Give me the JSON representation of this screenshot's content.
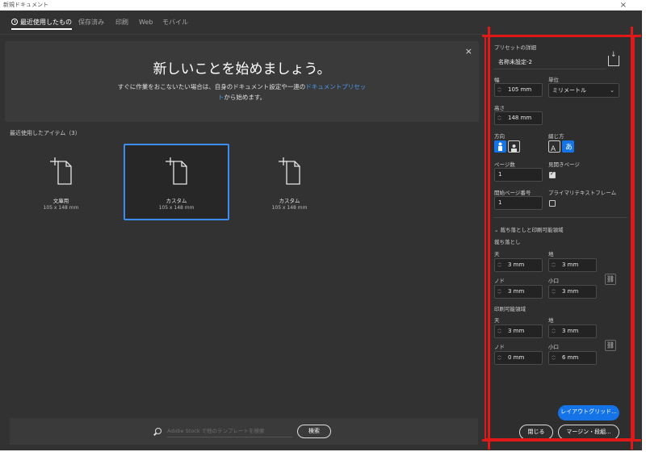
{
  "window": {
    "title": "新規ドキュメント",
    "close": "×"
  },
  "tabs": [
    {
      "label": "最近使用したもの"
    },
    {
      "label": "保存済み"
    },
    {
      "label": "印刷"
    },
    {
      "label": "Web"
    },
    {
      "label": "モバイル"
    }
  ],
  "hero": {
    "close": "×",
    "title": "新しいことを始めましょう。",
    "line1_pre": "すぐに作業をおこないたい場合は、自身のドキュメント設定や一連の",
    "line1_link": "ドキュメントプリセッ",
    "line2_link": "ト",
    "line2_post": "から始めます。"
  },
  "recent": {
    "title": "最近使用したアイテム（3）",
    "items": [
      {
        "name": "文庫用",
        "size": "105 x 148 mm"
      },
      {
        "name": "カスタム",
        "size": "105 x 148 mm"
      },
      {
        "name": "カスタム",
        "size": "105 x 148 mm"
      }
    ]
  },
  "search": {
    "placeholder": "Adobe Stock で他のテンプレートを検索",
    "button": "検索"
  },
  "preset": {
    "header": "プリセットの詳細",
    "name": "名称未設定-2",
    "width_label": "幅",
    "width": "105 mm",
    "unit_label": "単位",
    "unit": "ミリメートル",
    "height_label": "高さ",
    "height": "148 mm",
    "orientation_label": "方向",
    "binding_label": "綴じ方",
    "pages_label": "ページ数",
    "pages": "1",
    "facing_label": "見開きページ",
    "start_page_label": "開始ページ番号",
    "start_page": "1",
    "primary_frame_label": "プライマリテキストフレーム",
    "bleed_section": "裁ち落としと印刷可能領域",
    "bleed_label": "裁ち落とし",
    "slug_label": "印刷可能領域",
    "top_label": "天",
    "bottom_label": "地",
    "inside_label": "ノド",
    "outside_label": "小口",
    "bleed": {
      "top": "3 mm",
      "bottom": "3 mm",
      "inside": "3 mm",
      "outside": "3 mm"
    },
    "slug": {
      "top": "3 mm",
      "bottom": "3 mm",
      "inside": "0 mm",
      "outside": "6 mm"
    }
  },
  "buttons": {
    "layout_grid": "レイアウトグリッド...",
    "close": "閉じる",
    "margins_columns": "マージン・段組..."
  },
  "colors": {
    "accent": "#1473e6",
    "annotation": "#e01818",
    "panel_bg": "#2e2e2e"
  }
}
